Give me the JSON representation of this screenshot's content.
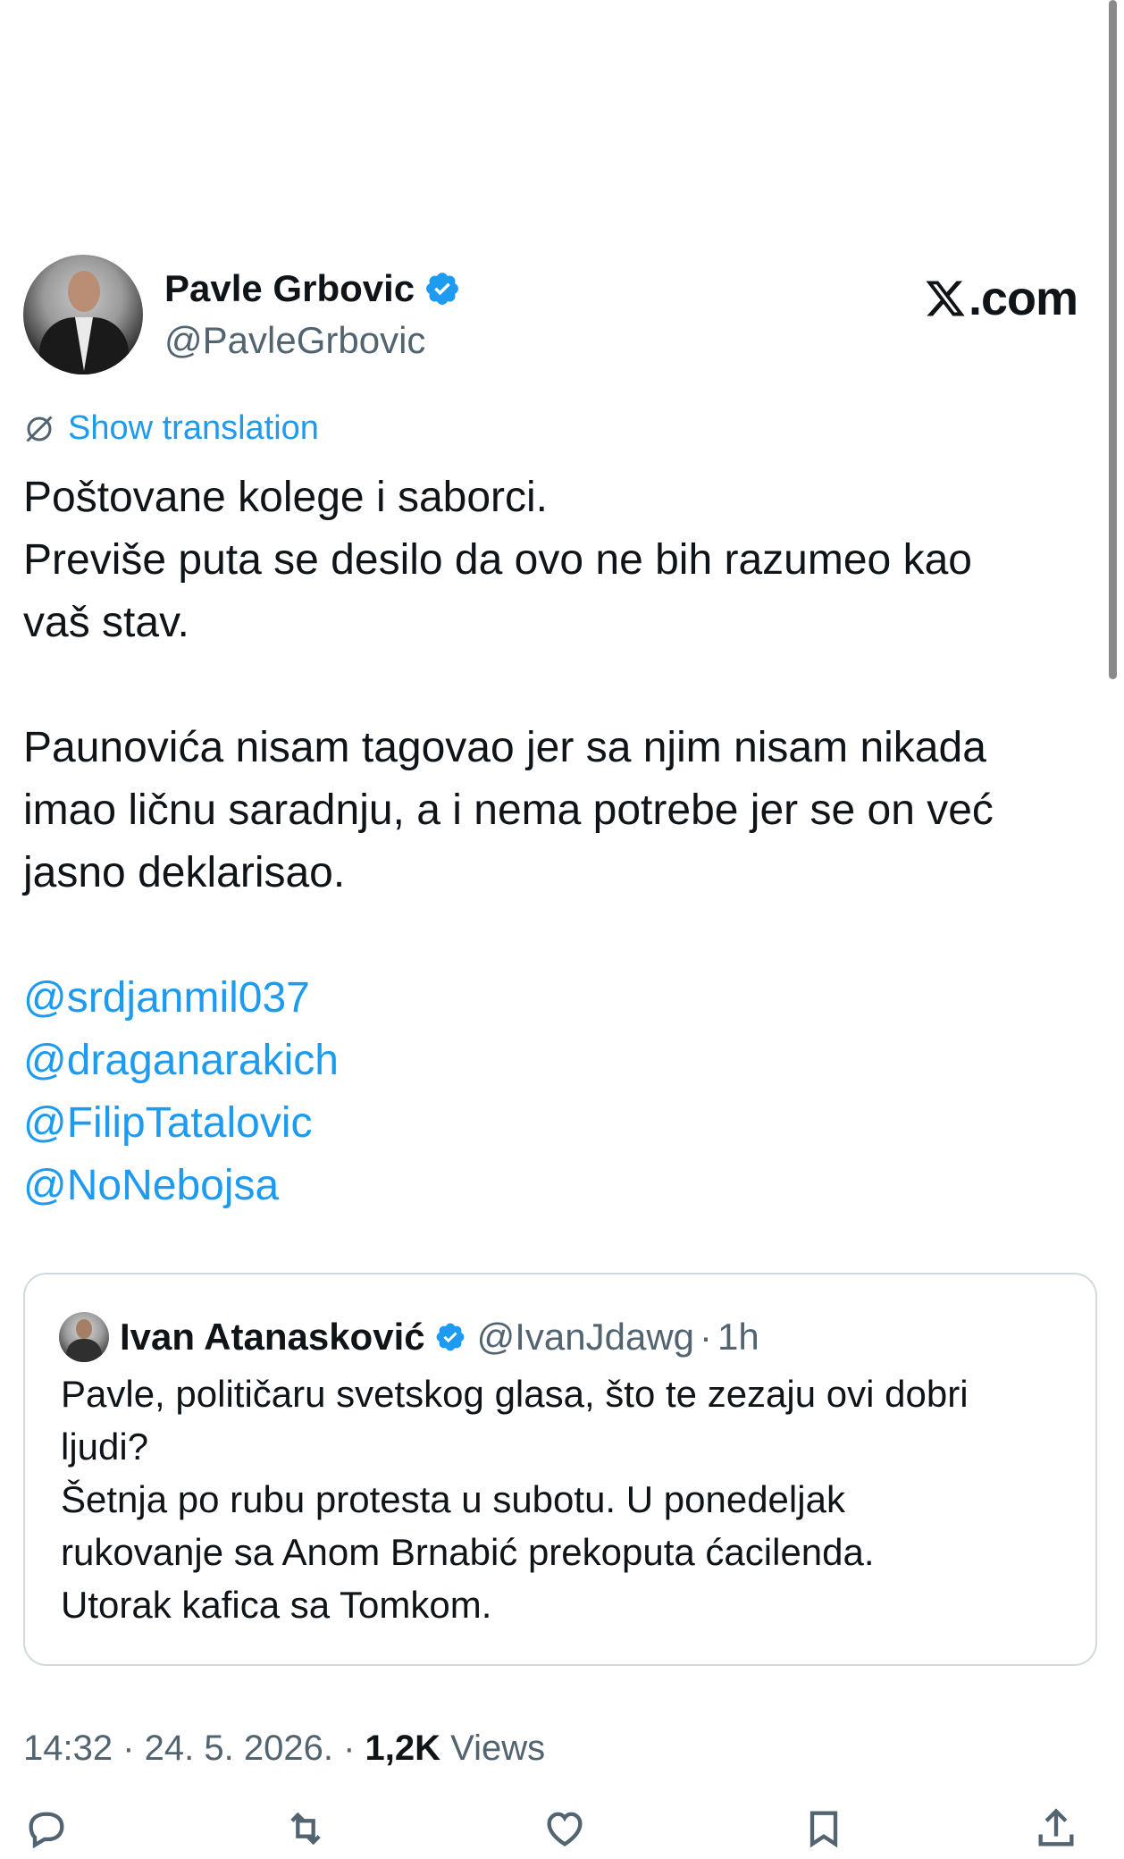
{
  "author": {
    "name": "Pavle Grbovic",
    "handle": "@PavleGrbovic",
    "verified": true,
    "avatar_icon": "person-photo"
  },
  "brand": {
    "logo_letter": "𝕏",
    "logo_suffix": ".com"
  },
  "translation": {
    "label": "Show translation",
    "icon": "translate-icon"
  },
  "tweet": {
    "lines": [
      "Poštovane kolege i saborci.",
      "Previše puta se desilo da ovo ne bih razumeo kao",
      "vaš stav.",
      "Paunovića nisam tagovao jer sa njim nisam nikada",
      "imao ličnu saradnju, a i nema potrebe jer se on već",
      "jasno deklarisao."
    ],
    "mentions": [
      "@srdjanmil037",
      "@draganarakich",
      "@FilipTatalovic",
      "@NoNebojsa"
    ]
  },
  "quote": {
    "name": "Ivan Atanasković",
    "handle": "@IvanJdawg",
    "time": "1h",
    "separator": "·",
    "verified": true,
    "lines": [
      "Pavle, političaru svetskog glasa, što te zezaju ovi dobri",
      "ljudi?",
      "Šetnja po rubu protesta u subotu. U ponedeljak",
      "rukovanje sa Anom Brnabić prekoputa ćacilenda.",
      "Utorak kafica sa Tomkom."
    ]
  },
  "meta": {
    "time": "14:32",
    "date": "24. 5. 2026.",
    "separator": " · ",
    "views_count": "1,2K",
    "views_label": "Views"
  },
  "colors": {
    "accent": "#1d9bf0",
    "text": "#0f1419",
    "secondary": "#536471",
    "border": "#cfd9de"
  }
}
